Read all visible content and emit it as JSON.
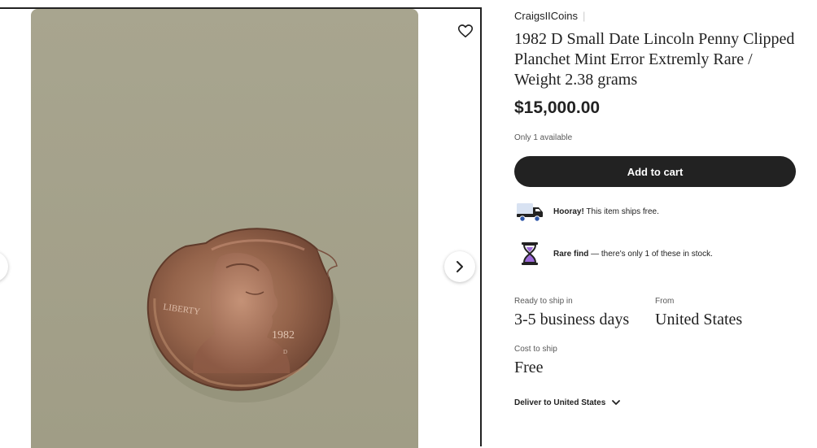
{
  "gallery": {
    "photo_description_name": "coin-photo",
    "favorite_icon": "heart-icon",
    "next_icon": "chevron-right-icon",
    "prev_icon": "chevron-left-icon",
    "coin_text_liberty": "LIBERTY",
    "coin_text_year": "1982",
    "coin_text_mint": "D"
  },
  "listing": {
    "shop_name": "CraigsIICoins",
    "title": "1982 D Small Date Lincoln Penny Clipped Planchet Mint Error Extremly Rare / Weight 2.38 grams",
    "price": "$15,000.00",
    "availability": "Only 1 available",
    "add_to_cart_label": "Add to cart"
  },
  "perks": [
    {
      "icon": "truck-icon",
      "bold": "Hooray!",
      "text": " This item ships free."
    },
    {
      "icon": "hourglass-icon",
      "bold": "Rare find",
      "text": " — there's only 1 of these in stock."
    }
  ],
  "shipping": {
    "ready_label": "Ready to ship in",
    "ready_value": "3-5 business days",
    "from_label": "From",
    "from_value": "United States",
    "cost_label": "Cost to ship",
    "cost_value": "Free",
    "deliver_label": "Deliver to United States",
    "deliver_icon": "chevron-down-icon"
  },
  "colors": {
    "button_bg": "#222222",
    "truck_accent": "#2f57a8",
    "hourglass_accent": "#9c6ad8",
    "photo_background": "#a5a38c"
  }
}
